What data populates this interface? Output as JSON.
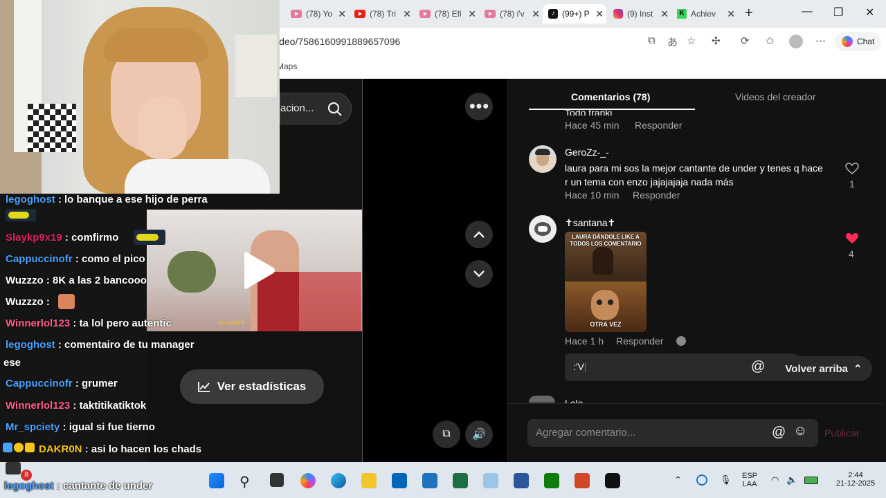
{
  "browser": {
    "tabs": [
      {
        "title": "(78) Yo",
        "favicon": "youtube-pink"
      },
      {
        "title": "(78) Tri",
        "favicon": "youtube"
      },
      {
        "title": "(78) Efi",
        "favicon": "youtube-pink"
      },
      {
        "title": "(78) i'v",
        "favicon": "youtube-pink"
      },
      {
        "title": "(99+) P",
        "favicon": "tiktok"
      },
      {
        "title": "(9) Inst",
        "favicon": "instagram"
      },
      {
        "title": "Achiev",
        "favicon": "kick"
      }
    ],
    "url": "ideo/7586160991889657096",
    "favorites_label": "Maps",
    "chat_label": "Chat"
  },
  "search": {
    "text": "acion..."
  },
  "comments": {
    "tab_comments": "Comentarios (78)",
    "tab_creator": "Videos del creador",
    "items": [
      {
        "text": "Todo tranki",
        "time": "Hace 45 min",
        "reply": "Responder"
      },
      {
        "user": "GeroZz-_-",
        "text_1": "laura para mi sos la mejor cantante de under y tenes q hace",
        "text_2": "r un tema con enzo jajajajaja nada más",
        "time": "Hace 10 min",
        "reply": "Responder",
        "likes": "1"
      },
      {
        "user": "✝santana✝",
        "meme_top": "LAURA DÁNDOLE LIKE A TODOS LOS COMENTARIO",
        "meme_bottom": "OTRA VEZ",
        "time": "Hace 1 h",
        "reply": "Responder",
        "likes": "4"
      },
      {
        "user": "Lolo"
      }
    ],
    "reply_value": ":'V",
    "back_to_top": "Volver arriba",
    "input_placeholder": "Agregar comentario...",
    "publish": "Publicar"
  },
  "stream_chat": [
    {
      "user": "legoghost",
      "msg": " : lo banque a ese hijo de perra",
      "color": "#4aa3ff"
    },
    {
      "user": "Slaykp9x19",
      "msg": " : comfirmo",
      "color": "#e0245e"
    },
    {
      "user": "Cappuccinofr",
      "msg": " : como el pico",
      "color": "#4aa3ff"
    },
    {
      "user": "Wuzzzo",
      "msg": " : 8K a las 2 bancooo",
      "color": "#ffffff"
    },
    {
      "user": "Wuzzzo",
      "msg": " :",
      "color": "#ffffff"
    },
    {
      "user": "Winnerlol123",
      "msg": " : ta lol pero autentic",
      "color": "#ff5c8a"
    },
    {
      "user": "legoghost",
      "msg": " : comentairo de tu manager",
      "color": "#4aa3ff"
    },
    {
      "user": "",
      "msg": "ese",
      "color": "#ffffff"
    },
    {
      "user": "Cappuccinofr",
      "msg": " : grumer",
      "color": "#4aa3ff"
    },
    {
      "user": "Winnerlol123",
      "msg": " : taktitikatiktok",
      "color": "#ff5c8a"
    },
    {
      "user": "Mr_spciety",
      "msg": " : igual si fue tierno",
      "color": "#4aa3ff"
    },
    {
      "user": "DAKR0N",
      "msg": " : asi lo hacen los chads",
      "color": "#f5c518"
    },
    {
      "user": "legoghost",
      "msg": " : cantante de under",
      "color": "#4aa3ff"
    }
  ],
  "video": {
    "stats_button": "Ver estadísticas",
    "caption": "es nueva"
  },
  "taskbar": {
    "lang_1": "ESP",
    "lang_2": "LAA",
    "time": "2:44",
    "date": "21-12-2025",
    "badge": "8"
  }
}
